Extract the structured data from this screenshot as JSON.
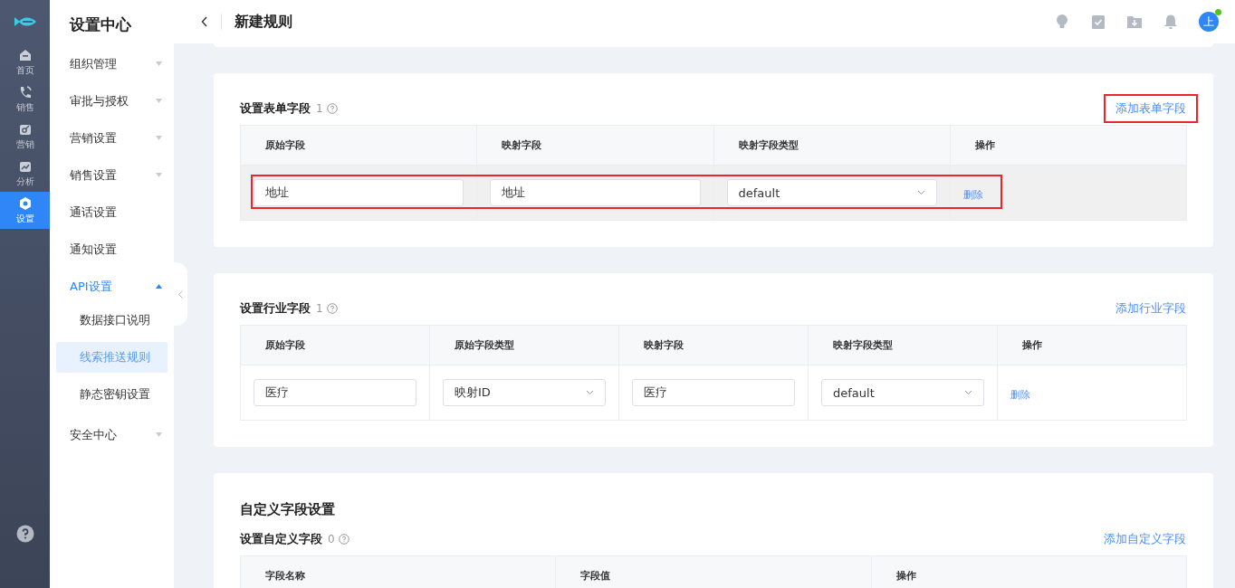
{
  "rail": {
    "items": [
      {
        "label": "首页",
        "selected": false
      },
      {
        "label": "销售",
        "selected": false
      },
      {
        "label": "营销",
        "selected": false
      },
      {
        "label": "分析",
        "selected": false
      },
      {
        "label": "设置",
        "selected": true
      }
    ]
  },
  "sidebar": {
    "title": "设置中心",
    "items": [
      {
        "label": "组织管理",
        "kind": "group",
        "expanded": false
      },
      {
        "label": "审批与授权",
        "kind": "group",
        "expanded": false
      },
      {
        "label": "营销设置",
        "kind": "group",
        "expanded": false
      },
      {
        "label": "销售设置",
        "kind": "group",
        "expanded": false
      },
      {
        "label": "通话设置",
        "kind": "link"
      },
      {
        "label": "通知设置",
        "kind": "link"
      },
      {
        "label": "API设置",
        "kind": "group",
        "expanded": true,
        "children": [
          {
            "label": "数据接口说明",
            "selected": false
          },
          {
            "label": "线索推送规则",
            "selected": true
          },
          {
            "label": "静态密钥设置",
            "selected": false
          }
        ]
      },
      {
        "label": "安全中心",
        "kind": "group",
        "expanded": false
      }
    ]
  },
  "header": {
    "title": "新建规则"
  },
  "user": {
    "initial": "上",
    "online": true
  },
  "sections": [
    {
      "title": "设置表单字段",
      "count": "1",
      "add_link": {
        "label": "添加表单字段",
        "highlighted": true
      },
      "table": {
        "columns": [
          "原始字段",
          "映射字段",
          "映射字段类型",
          "操作"
        ],
        "rows": [
          {
            "hovered": true,
            "highlighted": true,
            "cells": [
              {
                "kind": "input",
                "value": "地址"
              },
              {
                "kind": "input",
                "value": "地址"
              },
              {
                "kind": "select",
                "value": "default"
              },
              {
                "kind": "action",
                "label": "删除"
              }
            ]
          }
        ]
      }
    },
    {
      "title": "设置行业字段",
      "count": "1",
      "add_link": {
        "label": "添加行业字段",
        "highlighted": false
      },
      "table": {
        "columns": [
          "原始字段",
          "原始字段类型",
          "映射字段",
          "映射字段类型",
          "操作"
        ],
        "rows": [
          {
            "hovered": false,
            "highlighted": false,
            "cells": [
              {
                "kind": "input",
                "value": "医疗"
              },
              {
                "kind": "select",
                "value": "映射ID"
              },
              {
                "kind": "input",
                "value": "医疗"
              },
              {
                "kind": "select",
                "value": "default"
              },
              {
                "kind": "action",
                "label": "删除"
              }
            ]
          }
        ]
      }
    },
    {
      "heading": "自定义字段设置",
      "title": "设置自定义字段",
      "count": "0",
      "add_link": {
        "label": "添加自定义字段",
        "highlighted": false
      },
      "table": {
        "columns": [
          "字段名称",
          "字段值",
          "操作"
        ]
      }
    }
  ]
}
